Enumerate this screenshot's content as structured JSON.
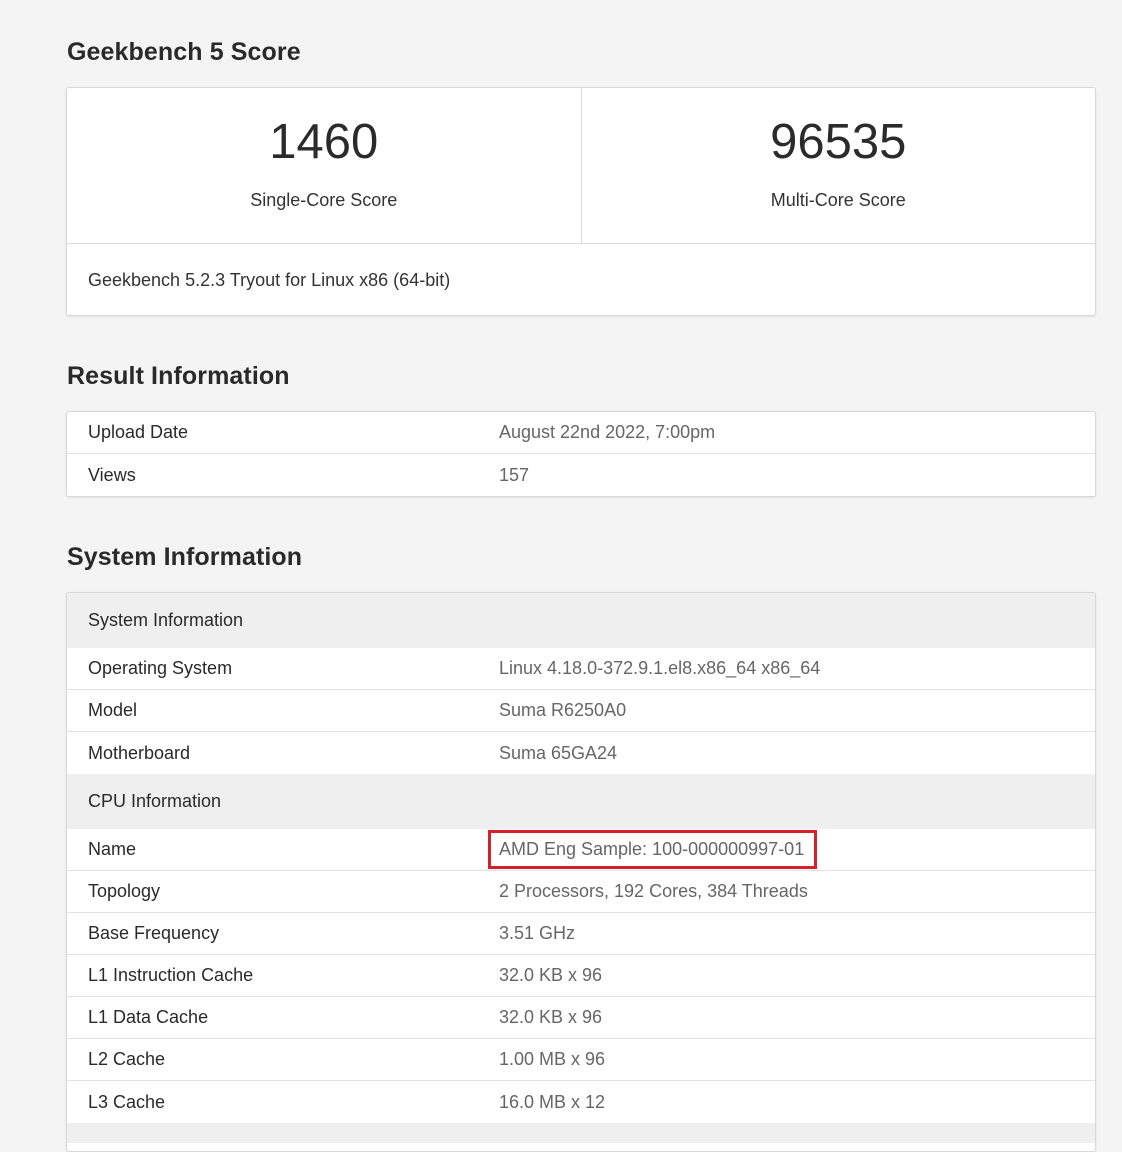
{
  "score_section": {
    "title": "Geekbench 5 Score",
    "single_core": {
      "value": "1460",
      "label": "Single-Core Score"
    },
    "multi_core": {
      "value": "96535",
      "label": "Multi-Core Score"
    },
    "version": "Geekbench 5.2.3 Tryout for Linux x86 (64-bit)"
  },
  "result_section": {
    "title": "Result Information",
    "rows": [
      {
        "key": "Upload Date",
        "value": "August 22nd 2022, 7:00pm"
      },
      {
        "key": "Views",
        "value": "157"
      }
    ]
  },
  "system_section": {
    "title": "System Information",
    "system_group": {
      "heading": "System Information",
      "rows": [
        {
          "key": "Operating System",
          "value": "Linux 4.18.0-372.9.1.el8.x86_64 x86_64"
        },
        {
          "key": "Model",
          "value": "Suma R6250A0"
        },
        {
          "key": "Motherboard",
          "value": "Suma 65GA24"
        }
      ]
    },
    "cpu_group": {
      "heading": "CPU Information",
      "name_row": {
        "key": "Name",
        "value": "AMD Eng Sample: 100-000000997-01"
      },
      "rows": [
        {
          "key": "Topology",
          "value": "2 Processors, 192 Cores, 384 Threads"
        },
        {
          "key": "Base Frequency",
          "value": "3.51 GHz"
        },
        {
          "key": "L1 Instruction Cache",
          "value": "32.0 KB x 96"
        },
        {
          "key": "L1 Data Cache",
          "value": "32.0 KB x 96"
        },
        {
          "key": "L2 Cache",
          "value": "1.00 MB x 96"
        },
        {
          "key": "L3 Cache",
          "value": "16.0 MB x 12"
        }
      ]
    }
  },
  "colors": {
    "highlight_border": "#d6212b",
    "page_background": "#f4f4f4",
    "group_background": "#efefef"
  }
}
